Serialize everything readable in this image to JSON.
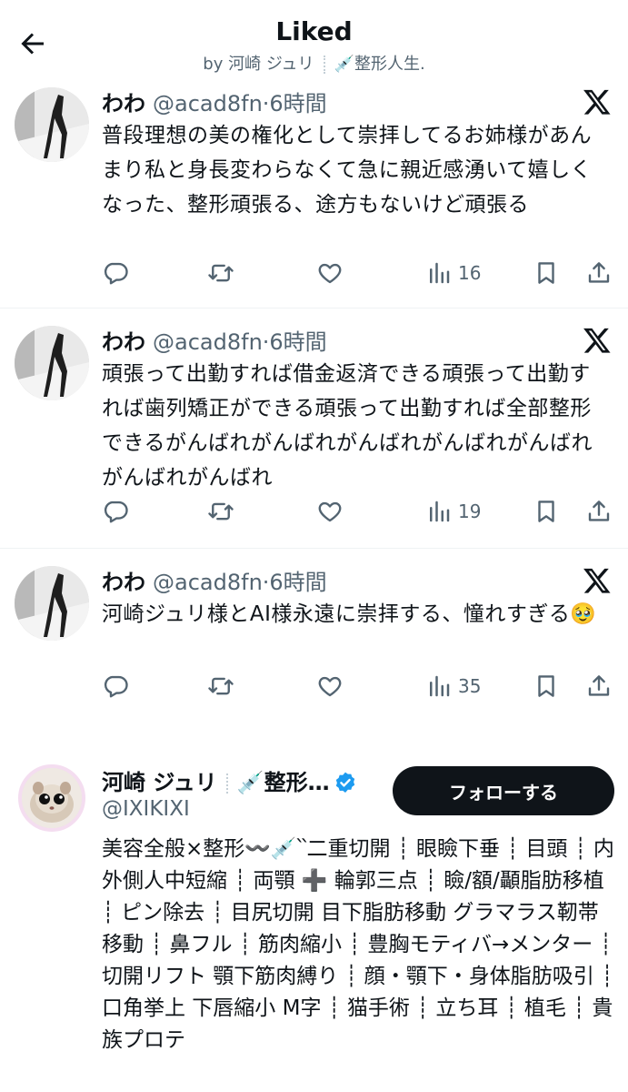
{
  "header": {
    "title": "Liked",
    "by": "by 河崎 ジュリ",
    "tag": "💉整形人生."
  },
  "tweets": [
    {
      "name": "わわ",
      "handle": "@acad8fn",
      "time": "·6時間",
      "text": "普段理想の美の権化として崇拝してるお姉様があんまり私と身長変わらなくて急に親近感湧いて嬉しくなった、整形頑張る、途方もないけど頑張る",
      "views": "16"
    },
    {
      "name": "わわ",
      "handle": "@acad8fn",
      "time": "·6時間",
      "text": "頑張って出勤すれば借金返済できる頑張って出勤すれば歯列矯正ができる頑張って出勤すれば全部整形できるがんばれがんばれがんばれがんばれがんばれがんばれがんばれ",
      "views": "19"
    },
    {
      "name": "わわ",
      "handle": "@acad8fn",
      "time": "·6時間",
      "text": "河崎ジュリ様とAI様永遠に崇拝する、憧れすぎる🥹",
      "views": "35"
    }
  ],
  "profile": {
    "name": "河崎 ジュリ",
    "name_tag": "💉整形…",
    "handle": "@IXIKIXI",
    "follow_label": "フォローする",
    "bio": "美容全般×整形〰️💉՝՝二重切開 ┊ 眼瞼下垂 ┊ 目頭 ┊ 内外側人中短縮 ┊ 両顎 ➕ 輪郭三点 ┊ 瞼/額/顳脂肪移植 ┊ ピン除去 ┊ 目尻切開 目下脂肪移動 グラマラス靭帯移動 ┊ 鼻フル ┊ 筋肉縮小 ┊ 豊胸モティバ→メンター ┊ 切開リフト 顎下筋肉縛り ┊ 顔・顎下・身体脂肪吸引 ┊ 口角挙上 下唇縮小 M字 ┊ 猫手術 ┊ 立ち耳 ┊ 植毛 ┊ 貴族プロテ"
  },
  "icons": [
    "back-arrow-icon",
    "x-logo-icon",
    "reply-icon",
    "retweet-icon",
    "like-icon",
    "views-icon",
    "bookmark-icon",
    "share-icon",
    "verified-badge-icon"
  ],
  "colors": {
    "text": "#0f1419",
    "secondary": "#536471",
    "verified": "#1d9bf0",
    "button": "#0f1419"
  }
}
